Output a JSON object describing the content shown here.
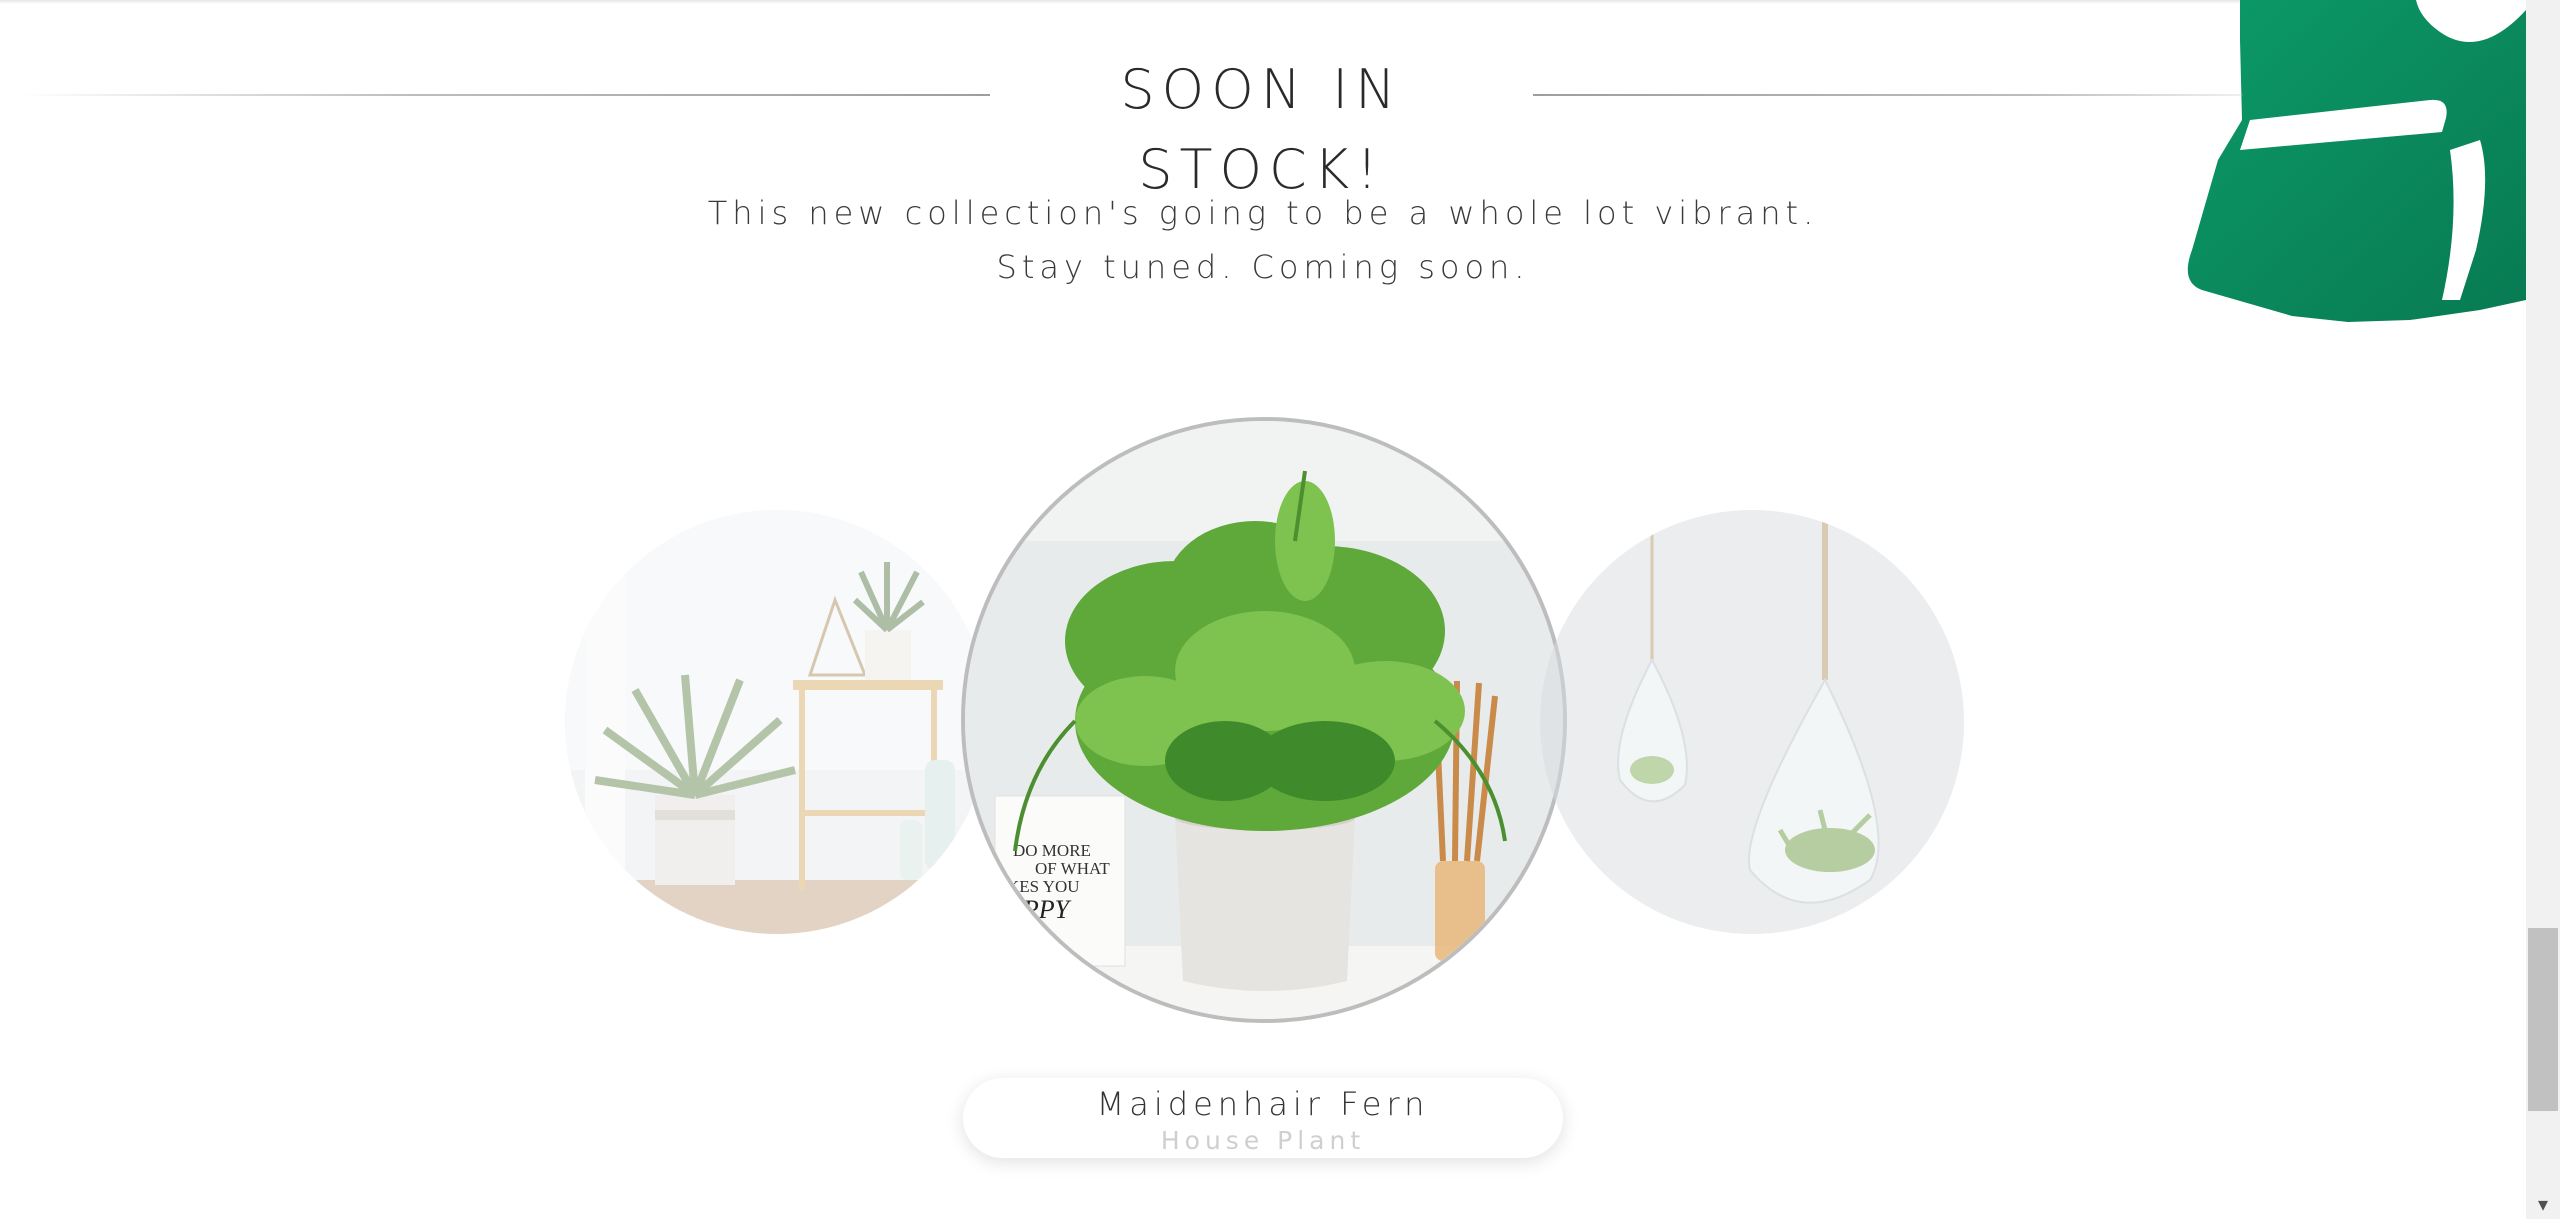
{
  "section": {
    "title": "SOON IN STOCK!",
    "subtitle_line1": "This new collection's going to be a whole lot vibrant.",
    "subtitle_line2": "Stay tuned. Coming soon."
  },
  "carousel": {
    "active": {
      "name": "Maidenhair Fern",
      "category": "House Plant",
      "poster_lines": [
        "DO MORE",
        "OF WHAT",
        "KES YOU",
        "APPY"
      ]
    },
    "items": [
      {
        "image": "sago-palm-plants-image"
      },
      {
        "image": "maidenhair-fern-image"
      },
      {
        "image": "hanging-glass-terrariums-image"
      }
    ]
  },
  "decoration": {
    "icon": "monstera-leaf-icon"
  },
  "scrollbar": {
    "arrow_icon": "scroll-down-arrow-icon",
    "arrow_glyph": "▾"
  },
  "colors": {
    "leaf": "#0d8a5f",
    "title": "#2a2a2a",
    "caption_sub": "#cfcfcf",
    "active_border": "#bdbdbd"
  }
}
